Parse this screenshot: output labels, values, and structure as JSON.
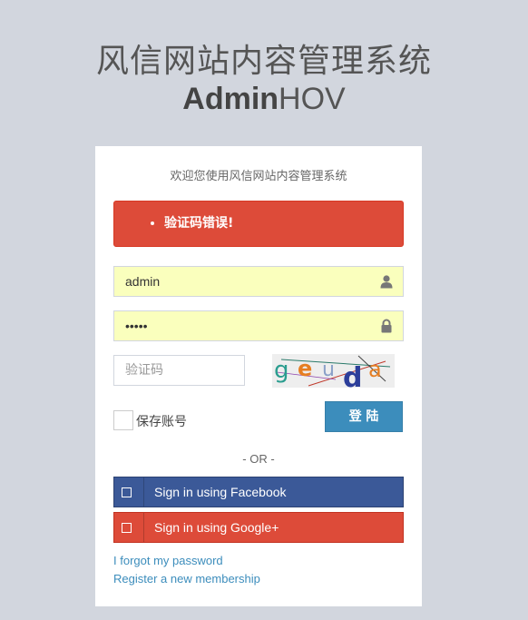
{
  "header": {
    "title_cn": "风信网站内容管理系统",
    "brand_bold": "Admin",
    "brand_light": "HOV"
  },
  "login": {
    "box_message": "欢迎您使用风信网站内容管理系统",
    "error_message": "验证码错误!",
    "username_value": "admin",
    "password_value": "•••••",
    "captcha_placeholder": "验证码",
    "captcha_text": "geuda",
    "remember_label": "保存账号",
    "login_button": "登 陆",
    "or_text": "- OR -",
    "facebook_button": "Sign in using Facebook",
    "google_button": "Sign in using Google+",
    "forgot_link": "I forgot my password",
    "register_link": "Register a new membership"
  },
  "colors": {
    "background": "#d2d6de",
    "error": "#dd4b39",
    "primary": "#3c8dbc",
    "facebook": "#3b5998",
    "google": "#dd4b39",
    "autofill": "#faffbd"
  },
  "icons": {
    "username": "user-icon",
    "password": "lock-icon",
    "facebook": "facebook-icon",
    "google": "google-plus-icon"
  }
}
